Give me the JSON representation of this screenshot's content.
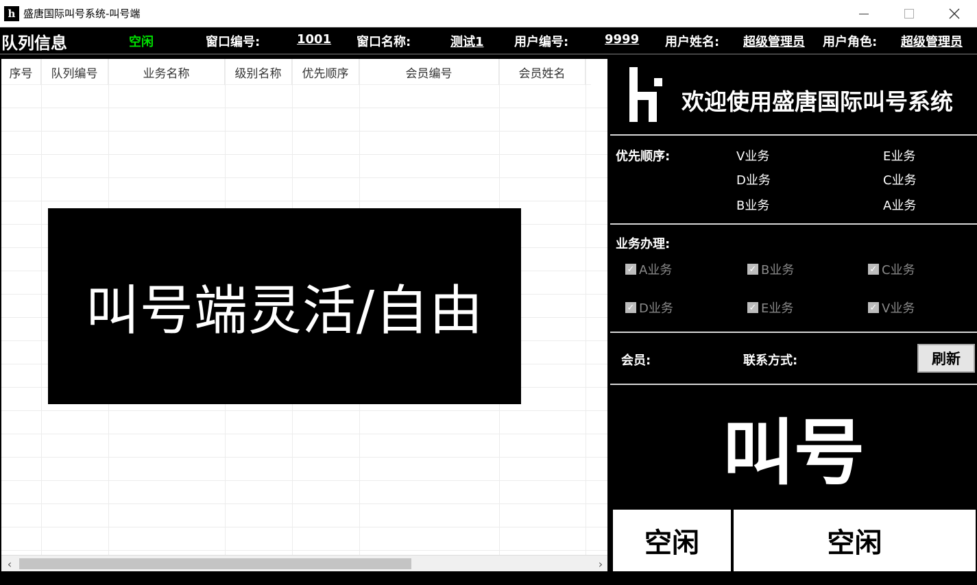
{
  "window": {
    "title": "盛唐国际叫号系统-叫号端",
    "icon_letter": "h"
  },
  "infobar": {
    "queue_title": "队列信息",
    "status": "空闲",
    "window_no_label": "窗口编号:",
    "window_no": "1001",
    "window_name_label": "窗口名称:",
    "window_name": "测试1",
    "user_no_label": "用户编号:",
    "user_no": "9999",
    "user_name_label": "用户姓名:",
    "user_name": "超级管理员",
    "user_role_label": "用户角色:",
    "user_role": "超级管理员"
  },
  "table": {
    "columns": [
      "序号",
      "队列编号",
      "业务名称",
      "级别名称",
      "优先顺序",
      "会员编号",
      "会员姓名"
    ],
    "rows": []
  },
  "overlay_text": "叫号端灵活/自由",
  "welcome": {
    "text": "欢迎使用盛唐国际叫号系统"
  },
  "priority": {
    "label": "优先顺序:",
    "items": [
      "V业务",
      "E业务",
      "D业务",
      "C业务",
      "B业务",
      "A业务"
    ]
  },
  "business": {
    "label": "业务办理:",
    "items": [
      {
        "label": "A业务",
        "checked": true
      },
      {
        "label": "B业务",
        "checked": true
      },
      {
        "label": "C业务",
        "checked": true
      },
      {
        "label": "D业务",
        "checked": true
      },
      {
        "label": "E业务",
        "checked": true
      },
      {
        "label": "V业务",
        "checked": true
      }
    ]
  },
  "member": {
    "member_label": "会员:",
    "contact_label": "联系方式:",
    "refresh_label": "刷新"
  },
  "call_button": "叫号",
  "bottom": {
    "left_status": "空闲",
    "right_status": "空闲"
  },
  "colors": {
    "status_green": "#00e000",
    "background": "#000000",
    "panel": "#ffffff"
  }
}
